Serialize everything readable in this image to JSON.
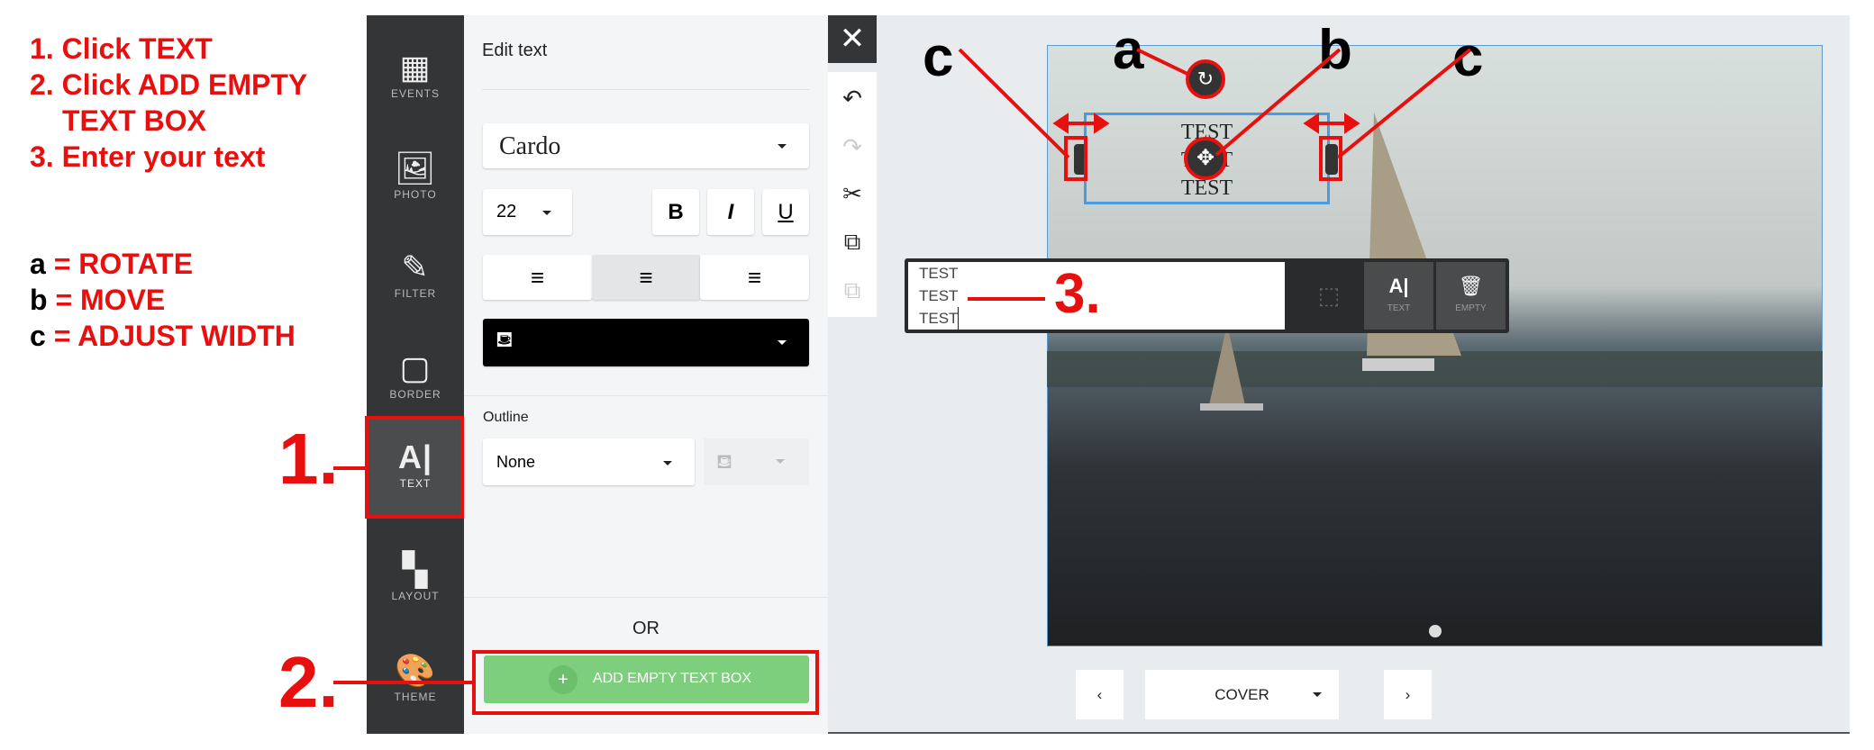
{
  "instructions": {
    "steps": [
      "1. Click TEXT",
      "2. Click ADD EMPTY",
      "TEXT BOX",
      "3. Enter your text"
    ],
    "legend": [
      {
        "key": "a",
        "value": "= ROTATE"
      },
      {
        "key": "b",
        "value": "= MOVE"
      },
      {
        "key": "c",
        "value": "= ADJUST WIDTH"
      }
    ],
    "markers": {
      "one": "1.",
      "two": "2.",
      "three": "3.",
      "a": "a",
      "b": "b",
      "c": "c"
    }
  },
  "sidebar": {
    "items": [
      {
        "label": "EVENTS",
        "icon": "calendar-icon"
      },
      {
        "label": "PHOTO",
        "icon": "image-icon"
      },
      {
        "label": "FILTER",
        "icon": "magic-wand-icon"
      },
      {
        "label": "BORDER",
        "icon": "border-icon"
      },
      {
        "label": "TEXT",
        "icon": "text-icon",
        "active": true
      },
      {
        "label": "LAYOUT",
        "icon": "layout-icon"
      },
      {
        "label": "THEME",
        "icon": "palette-icon"
      }
    ]
  },
  "panel": {
    "title": "Edit text",
    "font": "Cardo",
    "size": "22",
    "bold": "B",
    "italic": "I",
    "underline": "U",
    "color": "#000000",
    "outline_label": "Outline",
    "outline_value": "None",
    "or": "OR",
    "add_button": "ADD EMPTY TEXT BOX",
    "add_color": "#7dcf7d"
  },
  "canvas": {
    "text_lines": [
      "TEST",
      "TEST",
      "TEST"
    ],
    "editor_lines": [
      "TEST",
      "TEST",
      "TEST"
    ],
    "popup": {
      "text": "TEXT",
      "empty": "EMPTY"
    }
  },
  "nav": {
    "page": "COVER"
  },
  "colors": {
    "annotation": "#e8100f",
    "selection": "#4a9be0"
  }
}
